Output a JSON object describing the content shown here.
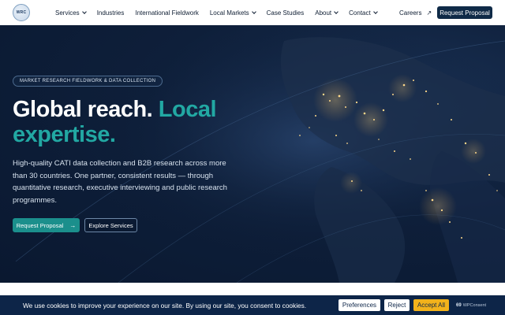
{
  "header": {
    "logo_text": "WRC",
    "nav": [
      {
        "label": "Services",
        "dropdown": true
      },
      {
        "label": "Industries",
        "dropdown": false
      },
      {
        "label": "International Fieldwork",
        "dropdown": false
      },
      {
        "label": "Local Markets",
        "dropdown": true
      },
      {
        "label": "Case Studies",
        "dropdown": false
      },
      {
        "label": "About",
        "dropdown": true
      },
      {
        "label": "Contact",
        "dropdown": true
      }
    ],
    "careers_label": "Careers",
    "careers_icon": "↗",
    "request_label": "Request Proposal"
  },
  "hero": {
    "badge": "MARKET RESEARCH FIELDWORK & DATA COLLECTION",
    "title_plain": "Global reach.",
    "title_accent_1": "Local",
    "title_accent_2": "expertise.",
    "lead": "High-quality CATI data collection and B2B research across more than 30 countries. One partner, consistent results — through quantitative research, executive interviewing and public research programmes.",
    "cta_primary": "Request Proposal",
    "cta_primary_icon": "→",
    "cta_secondary": "Explore Services",
    "accent_color": "#22a8a3",
    "bg_color": "#0e1f3a"
  },
  "cookie": {
    "text": "We use cookies to improve your experience on our site. By using our site, you consent to cookies.",
    "preferences": "Preferences",
    "reject": "Reject",
    "accept": "Accept All",
    "brand_icon": "69",
    "brand": "WPConsent"
  }
}
